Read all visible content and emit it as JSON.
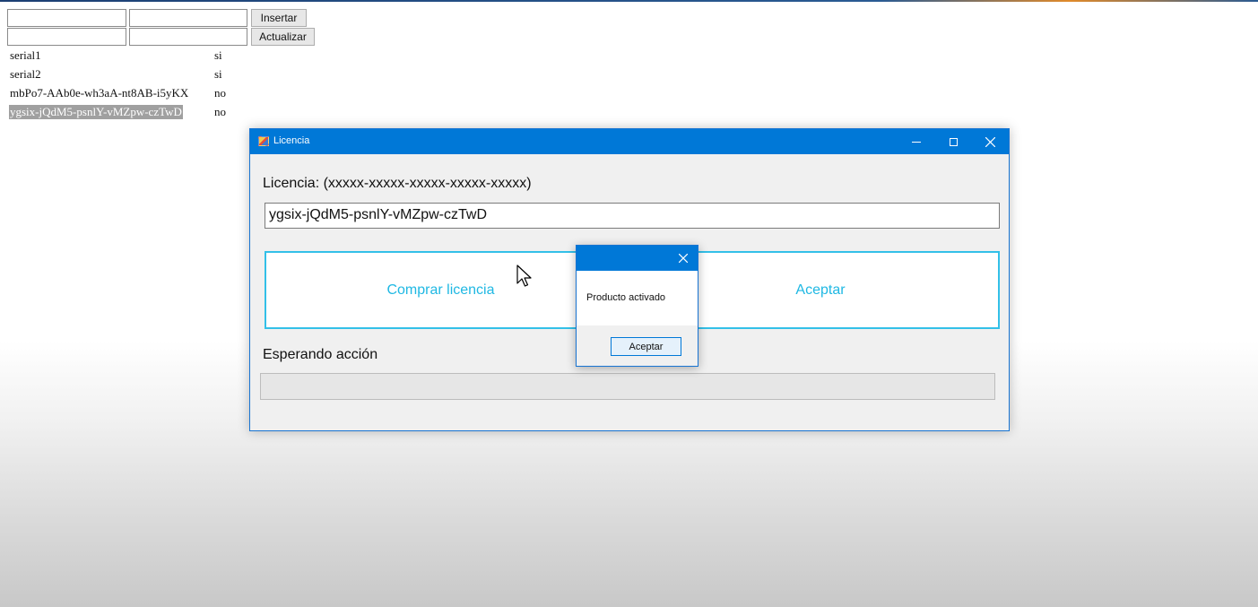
{
  "form": {
    "row1": {
      "field1": "",
      "field2": "",
      "button": "Insertar"
    },
    "row2": {
      "field1": "",
      "field2": "",
      "button": "Actualizar"
    }
  },
  "grid": {
    "rows": [
      {
        "serial": "serial1",
        "active": "si"
      },
      {
        "serial": "serial2",
        "active": "si"
      },
      {
        "serial": "mbPo7-AAb0e-wh3aA-nt8AB-i5yKX",
        "active": "no"
      },
      {
        "serial": "ygsix-jQdM5-psnlY-vMZpw-czTwD",
        "active": "no"
      }
    ]
  },
  "licencia_window": {
    "title": "Licencia",
    "icon": "app-icon",
    "license_label": "Licencia: (xxxxx-xxxxx-xxxxx-xxxxx-xxxxx)",
    "license_value": "ygsix-jQdM5-psnlY-vMZpw-czTwD",
    "buy_button": "Comprar licencia",
    "accept_button": "Aceptar",
    "status_label": "Esperando acción",
    "progress": 0
  },
  "message_box": {
    "text": "Producto activado",
    "ok_button": "Aceptar"
  },
  "colors": {
    "titlebar": "#0078d7",
    "button_text": "#1fb8e3",
    "button_border": "#33c0e8"
  }
}
